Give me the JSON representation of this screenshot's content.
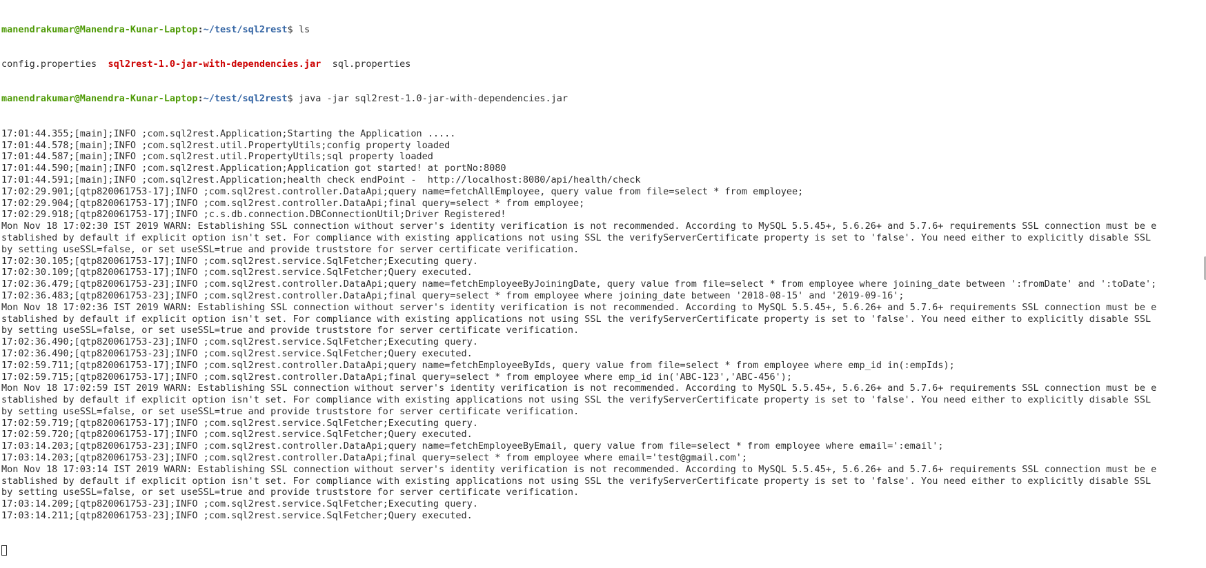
{
  "prompt": {
    "user": "manendrakumar@Manendra-Kunar-Laptop",
    "path": "~/test/sql2rest",
    "symbol": "$"
  },
  "commands": {
    "ls": "ls",
    "java": "java -jar sql2rest-1.0-jar-with-dependencies.jar"
  },
  "ls_output": [
    {
      "name": "config.properties",
      "gap": "  ",
      "type": "file"
    },
    {
      "name": "sql2rest-1.0-jar-with-dependencies.jar",
      "gap": "  ",
      "type": "jar"
    },
    {
      "name": "sql.properties",
      "gap": "",
      "type": "file"
    }
  ],
  "log_lines": [
    "17:01:44.355;[main];INFO ;com.sql2rest.Application;Starting the Application .....",
    "17:01:44.578;[main];INFO ;com.sql2rest.util.PropertyUtils;config property loaded",
    "17:01:44.587;[main];INFO ;com.sql2rest.util.PropertyUtils;sql property loaded",
    "17:01:44.590;[main];INFO ;com.sql2rest.Application;Application got started! at portNo:8080",
    "17:01:44.591;[main];INFO ;com.sql2rest.Application;health check endPoint -  http://localhost:8080/api/health/check",
    "17:02:29.901;[qtp820061753-17];INFO ;com.sql2rest.controller.DataApi;query name=fetchAllEmployee, query value from file=select * from employee;",
    "17:02:29.904;[qtp820061753-17];INFO ;com.sql2rest.controller.DataApi;final query=select * from employee;",
    "17:02:29.918;[qtp820061753-17];INFO ;c.s.db.connection.DBConnectionUtil;Driver Registered!",
    "Mon Nov 18 17:02:30 IST 2019 WARN: Establishing SSL connection without server's identity verification is not recommended. According to MySQL 5.5.45+, 5.6.26+ and 5.7.6+ requirements SSL connection must be e",
    "stablished by default if explicit option isn't set. For compliance with existing applications not using SSL the verifyServerCertificate property is set to 'false'. You need either to explicitly disable SSL",
    "by setting useSSL=false, or set useSSL=true and provide truststore for server certificate verification.",
    "17:02:30.105;[qtp820061753-17];INFO ;com.sql2rest.service.SqlFetcher;Executing query.",
    "17:02:30.109;[qtp820061753-17];INFO ;com.sql2rest.service.SqlFetcher;Query executed.",
    "17:02:36.479;[qtp820061753-23];INFO ;com.sql2rest.controller.DataApi;query name=fetchEmployeeByJoiningDate, query value from file=select * from employee where joining_date between ':fromDate' and ':toDate';",
    "17:02:36.483;[qtp820061753-23];INFO ;com.sql2rest.controller.DataApi;final query=select * from employee where joining_date between '2018-08-15' and '2019-09-16';",
    "Mon Nov 18 17:02:36 IST 2019 WARN: Establishing SSL connection without server's identity verification is not recommended. According to MySQL 5.5.45+, 5.6.26+ and 5.7.6+ requirements SSL connection must be e",
    "stablished by default if explicit option isn't set. For compliance with existing applications not using SSL the verifyServerCertificate property is set to 'false'. You need either to explicitly disable SSL",
    "by setting useSSL=false, or set useSSL=true and provide truststore for server certificate verification.",
    "17:02:36.490;[qtp820061753-23];INFO ;com.sql2rest.service.SqlFetcher;Executing query.",
    "17:02:36.490;[qtp820061753-23];INFO ;com.sql2rest.service.SqlFetcher;Query executed.",
    "17:02:59.711;[qtp820061753-17];INFO ;com.sql2rest.controller.DataApi;query name=fetchEmployeeByIds, query value from file=select * from employee where emp_id in(:empIds);",
    "17:02:59.715;[qtp820061753-17];INFO ;com.sql2rest.controller.DataApi;final query=select * from employee where emp_id in('ABC-123','ABC-456');",
    "Mon Nov 18 17:02:59 IST 2019 WARN: Establishing SSL connection without server's identity verification is not recommended. According to MySQL 5.5.45+, 5.6.26+ and 5.7.6+ requirements SSL connection must be e",
    "stablished by default if explicit option isn't set. For compliance with existing applications not using SSL the verifyServerCertificate property is set to 'false'. You need either to explicitly disable SSL",
    "by setting useSSL=false, or set useSSL=true and provide truststore for server certificate verification.",
    "17:02:59.719;[qtp820061753-17];INFO ;com.sql2rest.service.SqlFetcher;Executing query.",
    "17:02:59.720;[qtp820061753-17];INFO ;com.sql2rest.service.SqlFetcher;Query executed.",
    "17:03:14.203;[qtp820061753-23];INFO ;com.sql2rest.controller.DataApi;query name=fetchEmployeeByEmail, query value from file=select * from employee where email=':email';",
    "17:03:14.203;[qtp820061753-23];INFO ;com.sql2rest.controller.DataApi;final query=select * from employee where email='test@gmail.com';",
    "Mon Nov 18 17:03:14 IST 2019 WARN: Establishing SSL connection without server's identity verification is not recommended. According to MySQL 5.5.45+, 5.6.26+ and 5.7.6+ requirements SSL connection must be e",
    "stablished by default if explicit option isn't set. For compliance with existing applications not using SSL the verifyServerCertificate property is set to 'false'. You need either to explicitly disable SSL",
    "by setting useSSL=false, or set useSSL=true and provide truststore for server certificate verification.",
    "17:03:14.209;[qtp820061753-23];INFO ;com.sql2rest.service.SqlFetcher;Executing query.",
    "17:03:14.211;[qtp820061753-23];INFO ;com.sql2rest.service.SqlFetcher;Query executed."
  ],
  "colors": {
    "background": "#ffffff",
    "text": "#2e2e2e",
    "prompt_user": "#4e9a06",
    "prompt_path": "#3465a4",
    "jar_file": "#cc0000"
  }
}
